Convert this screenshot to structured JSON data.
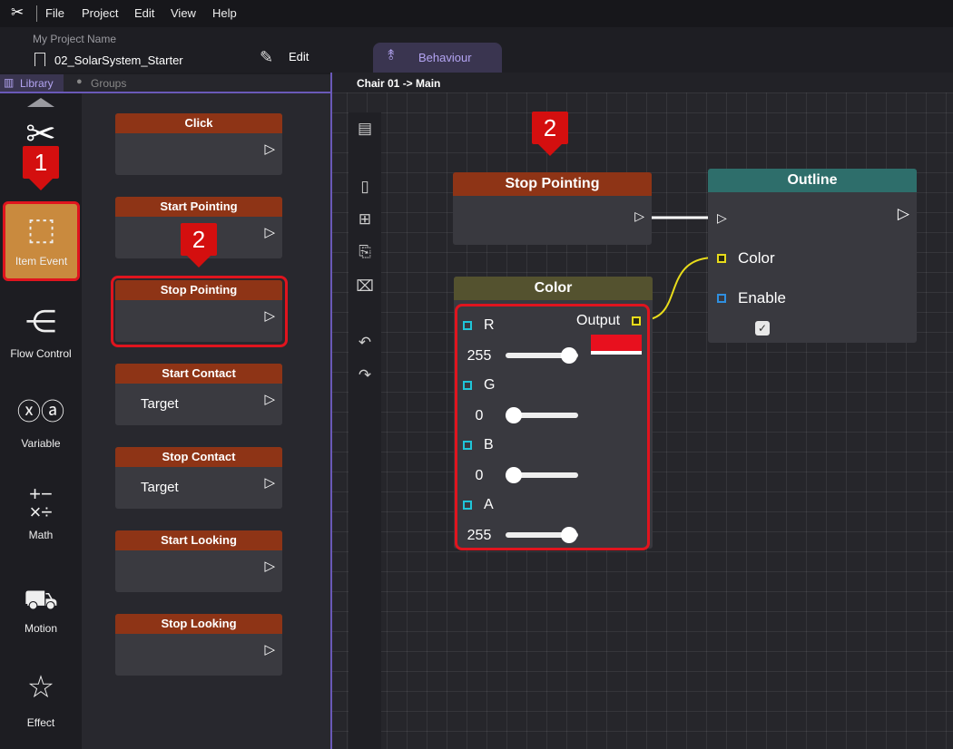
{
  "menubar": {
    "items": [
      "File",
      "Project",
      "Edit",
      "View",
      "Help"
    ]
  },
  "project": {
    "label": "My Project Name",
    "name": "02_SolarSystem_Starter",
    "edit_label": "Edit",
    "behaviour_tab": "Behaviour"
  },
  "left_tabs": {
    "library": "Library",
    "groups": "Groups"
  },
  "breadcrumb": "Chair 01 -> Main",
  "categories": [
    {
      "label": "Item Event",
      "icon": "cube-touch-icon",
      "selected": true
    },
    {
      "label": "Flow Control",
      "icon": "flow-branch-icon"
    },
    {
      "label": "Variable",
      "icon": "variable-xya-icon"
    },
    {
      "label": "Math",
      "icon": "math-operators-icon"
    },
    {
      "label": "Motion",
      "icon": "car-icon"
    },
    {
      "label": "Effect",
      "icon": "star-sparkle-icon"
    }
  ],
  "events": [
    {
      "title": "Click",
      "target": ""
    },
    {
      "title": "Start Pointing",
      "target": ""
    },
    {
      "title": "Stop Pointing",
      "target": "",
      "highlighted": true
    },
    {
      "title": "Start Contact",
      "target": "Target"
    },
    {
      "title": "Stop Contact",
      "target": "Target"
    },
    {
      "title": "Start Looking",
      "target": ""
    },
    {
      "title": "Stop Looking",
      "target": ""
    }
  ],
  "nodes": {
    "stop_pointing": {
      "title": "Stop Pointing",
      "color": "#8e3416"
    },
    "outline": {
      "title": "Outline",
      "color": "#2e6e6b",
      "color_port": "Color",
      "enable_port": "Enable",
      "enable_checked": true
    },
    "color": {
      "title": "Color",
      "header_color": "#54522f",
      "output_label": "Output",
      "swatch": "#e8101e",
      "channels": [
        {
          "label": "R",
          "value": "255",
          "level": 1.0
        },
        {
          "label": "G",
          "value": "0",
          "level": 0.0
        },
        {
          "label": "B",
          "value": "0",
          "level": 0.0
        },
        {
          "label": "A",
          "value": "255",
          "level": 1.0
        }
      ]
    }
  },
  "markers": {
    "step1": "1",
    "step2_library": "2",
    "step2_canvas": "2"
  },
  "colors": {
    "accent": "#6a59b8",
    "event_header": "#8e3416",
    "highlight": "#e0141e",
    "category_selected": "#c98a3e"
  }
}
